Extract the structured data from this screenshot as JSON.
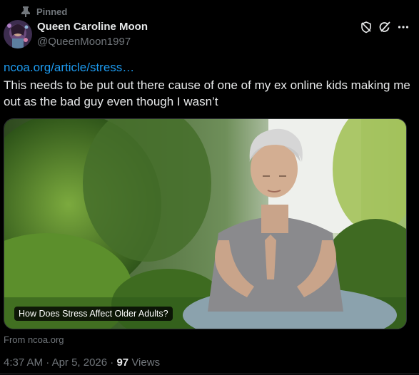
{
  "pinned_label": "Pinned",
  "user": {
    "display_name": "Queen Caroline Moon",
    "handle": "@QueenMoon1997"
  },
  "tweet": {
    "link_text": "ncoa.org/article/stress…",
    "text": "This needs to be put out there cause of one of my ex online kids making me out as the bad guy even though I wasn’t"
  },
  "card": {
    "caption": "How Does Stress Affect Older Adults?",
    "source": "From ncoa.org"
  },
  "meta": {
    "time": "4:37 AM",
    "separator": " · ",
    "date": "Apr 5, 2026",
    "views_count": "97",
    "views_label": " Views"
  },
  "icons": {
    "pin": "pin-icon",
    "shield": "shield-slash-icon",
    "grok": "grok-icon",
    "more": "more-icon"
  },
  "colors": {
    "background": "#000000",
    "primary_text": "#e7e9ea",
    "secondary_text": "#71767b",
    "link": "#1d9bf0",
    "border": "#2f3336"
  }
}
